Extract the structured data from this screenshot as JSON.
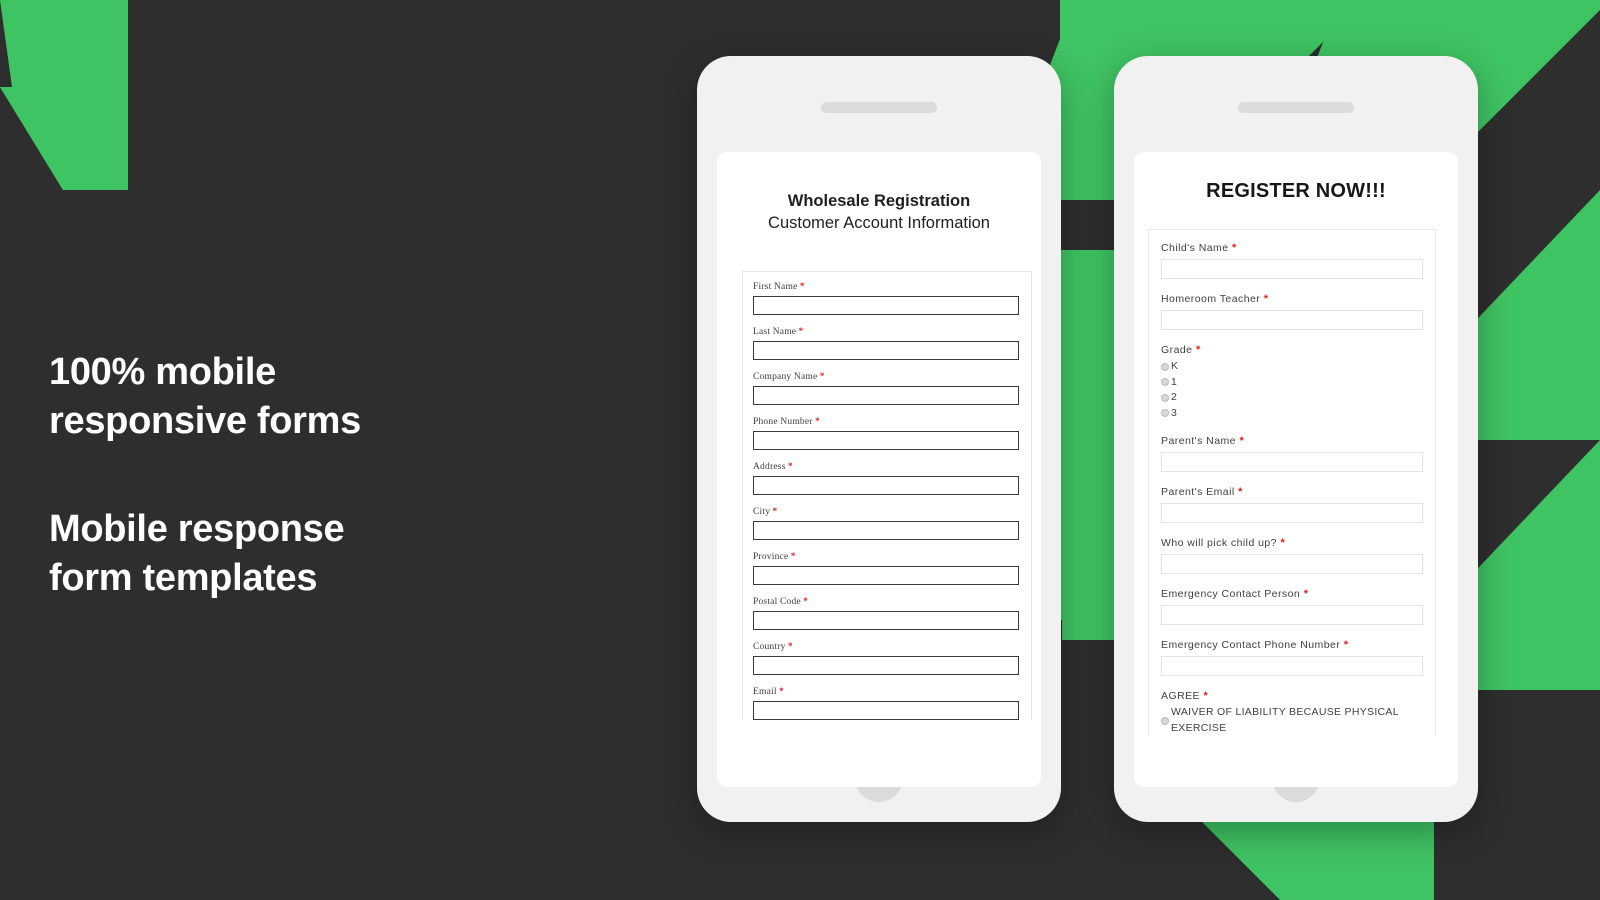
{
  "theme": {
    "background": "#2e2e2e",
    "accent_green": "#3fc463",
    "phone_body": "#f1f1f1",
    "screen": "#ffffff",
    "required_marker": "#e02020"
  },
  "headline": {
    "line1": "100% mobile",
    "line2": "responsive forms",
    "line3": "Mobile response",
    "line4": "form templates"
  },
  "required_symbol": "*",
  "phone_left": {
    "device_name": "mobile-phone-mockup-left",
    "form": {
      "title_line1": "Wholesale Registration",
      "title_line2": "Customer Account Information",
      "fields": [
        {
          "label": "First Name",
          "required": true,
          "value": ""
        },
        {
          "label": "Last Name",
          "required": true,
          "value": ""
        },
        {
          "label": "Company Name",
          "required": true,
          "value": ""
        },
        {
          "label": "Phone Number",
          "required": true,
          "value": ""
        },
        {
          "label": "Address",
          "required": true,
          "value": ""
        },
        {
          "label": "City",
          "required": true,
          "value": ""
        },
        {
          "label": "Province",
          "required": true,
          "value": ""
        },
        {
          "label": "Postal Code",
          "required": true,
          "value": ""
        },
        {
          "label": "Country",
          "required": true,
          "value": ""
        },
        {
          "label": "Email",
          "required": true,
          "value": ""
        }
      ]
    }
  },
  "phone_right": {
    "device_name": "mobile-phone-mockup-right",
    "form": {
      "title": "REGISTER NOW!!!",
      "fields": [
        {
          "type": "text",
          "label": "Child's Name",
          "required": true,
          "value": ""
        },
        {
          "type": "text",
          "label": "Homeroom Teacher",
          "required": true,
          "value": ""
        },
        {
          "type": "radio",
          "label": "Grade",
          "required": true,
          "options": [
            "K",
            "1",
            "2",
            "3"
          ],
          "selected": null
        },
        {
          "type": "text",
          "label": "Parent's Name",
          "required": true,
          "value": ""
        },
        {
          "type": "text",
          "label": "Parent's Email",
          "required": true,
          "value": ""
        },
        {
          "type": "text",
          "label": "Who will pick child up?",
          "required": true,
          "value": ""
        },
        {
          "type": "text",
          "label": "Emergency Contact Person",
          "required": true,
          "value": ""
        },
        {
          "type": "text",
          "label": "Emergency Contact Phone Number",
          "required": true,
          "value": ""
        },
        {
          "type": "radio",
          "label": "AGREE",
          "required": true,
          "options": [
            "WAIVER OF LIABILITY BECAUSE PHYSICAL EXERCISE"
          ],
          "selected": null
        }
      ]
    }
  }
}
